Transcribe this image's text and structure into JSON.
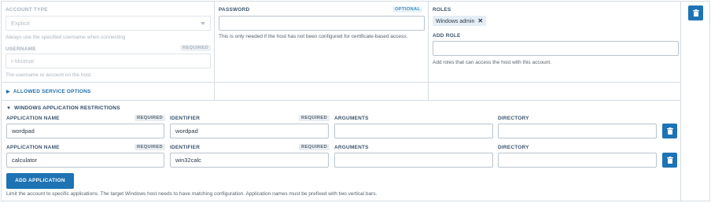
{
  "account": {
    "type_label": "Account Type",
    "type_value": "Explicit",
    "type_hint": "Always use the specified username when connecting",
    "username_label": "Username",
    "username_required": "Required",
    "username_value": "r-kkumar",
    "username_hint": "The username or account on the host."
  },
  "password": {
    "label": "Password",
    "optional": "Optional",
    "value": "",
    "hint": "This is only needed if the host has not been configured for certificate-based access."
  },
  "roles": {
    "label": "Roles",
    "chips": [
      "Windows admin"
    ],
    "remove_glyph": "✕",
    "add_label": "Add Role",
    "add_value": "",
    "add_hint": "Add roles that can access the host with this account."
  },
  "allowed_service": {
    "glyph": "▶",
    "label": "Allowed Service Options"
  },
  "restrictions": {
    "glyph": "▼",
    "label": "Windows Application Restrictions",
    "rows": [
      {
        "app_label": "Application Name",
        "app_required": "Required",
        "app_value": "wordpad",
        "id_label": "Identifier",
        "id_required": "Required",
        "id_value": "wordpad",
        "args_label": "Arguments",
        "args_value": "",
        "dir_label": "Directory",
        "dir_value": ""
      },
      {
        "app_label": "Application Name",
        "app_required": "Required",
        "app_value": "calculator",
        "id_label": "Identifier",
        "id_required": "Required",
        "id_value": "win32calc",
        "args_label": "Arguments",
        "args_value": "",
        "dir_label": "Directory",
        "dir_value": ""
      }
    ],
    "add_button": "Add Application",
    "hint": "Limit the account to specific applications. The target Windows host needs to have matching configuration. Application names must be prefixed with two vertical bars."
  },
  "icons": {
    "delete": "trash-icon",
    "dropdown": "chevron-down-icon",
    "collapse": "triangle-icon"
  },
  "colors": {
    "primary": "#1d73b4",
    "label": "#3d556e",
    "border": "#b9c4ce",
    "chip_bg": "#e5eef5",
    "optional": "#3f8fc2"
  }
}
